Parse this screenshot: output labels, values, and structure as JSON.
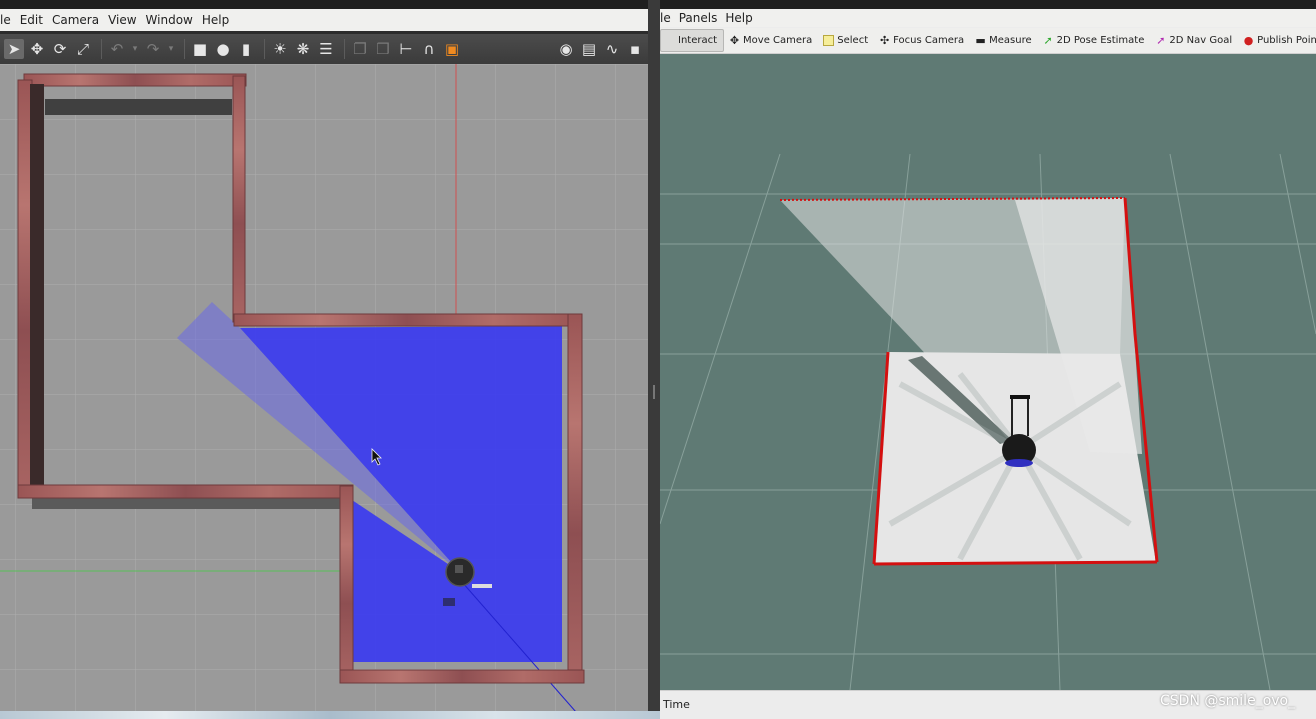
{
  "gazebo": {
    "menu": [
      "le",
      "Edit",
      "Camera",
      "View",
      "Window",
      "Help"
    ],
    "toolbar_icons": [
      "select-arrow-icon",
      "translate-icon",
      "rotate-icon",
      "scale-icon",
      "undo-icon",
      "undo-dropdown-icon",
      "redo-icon",
      "redo-dropdown-icon",
      "box-icon",
      "sphere-icon",
      "cylinder-icon",
      "point-light-icon",
      "spot-light-icon",
      "directional-light-icon",
      "copy-icon",
      "paste-icon",
      "align-icon",
      "snap-icon",
      "view-angle-icon",
      "screenshot-icon",
      "log-icon",
      "plot-icon",
      "video-record-icon"
    ]
  },
  "rviz": {
    "menu": [
      "le",
      "Panels",
      "Help"
    ],
    "tools": [
      {
        "label": "Interact",
        "icon": "interact-icon"
      },
      {
        "label": "Move Camera",
        "icon": "move-camera-icon"
      },
      {
        "label": "Select",
        "icon": "select-icon"
      },
      {
        "label": "Focus Camera",
        "icon": "focus-camera-icon"
      },
      {
        "label": "Measure",
        "icon": "measure-icon"
      },
      {
        "label": "2D Pose Estimate",
        "icon": "pose-estimate-icon"
      },
      {
        "label": "2D Nav Goal",
        "icon": "nav-goal-icon"
      },
      {
        "label": "Publish Point",
        "icon": "publish-point-icon"
      }
    ],
    "status_label": "Time"
  },
  "watermark": "CSDN @smile_ovo_",
  "colors": {
    "gazebo_ground": "#9a9a9a",
    "laser_blue": "#3b3bf0",
    "wall_brick": "#a0585a",
    "rviz_background": "#5f7a74",
    "map_free": "#e4e4e4",
    "map_wall": "#d41010"
  }
}
